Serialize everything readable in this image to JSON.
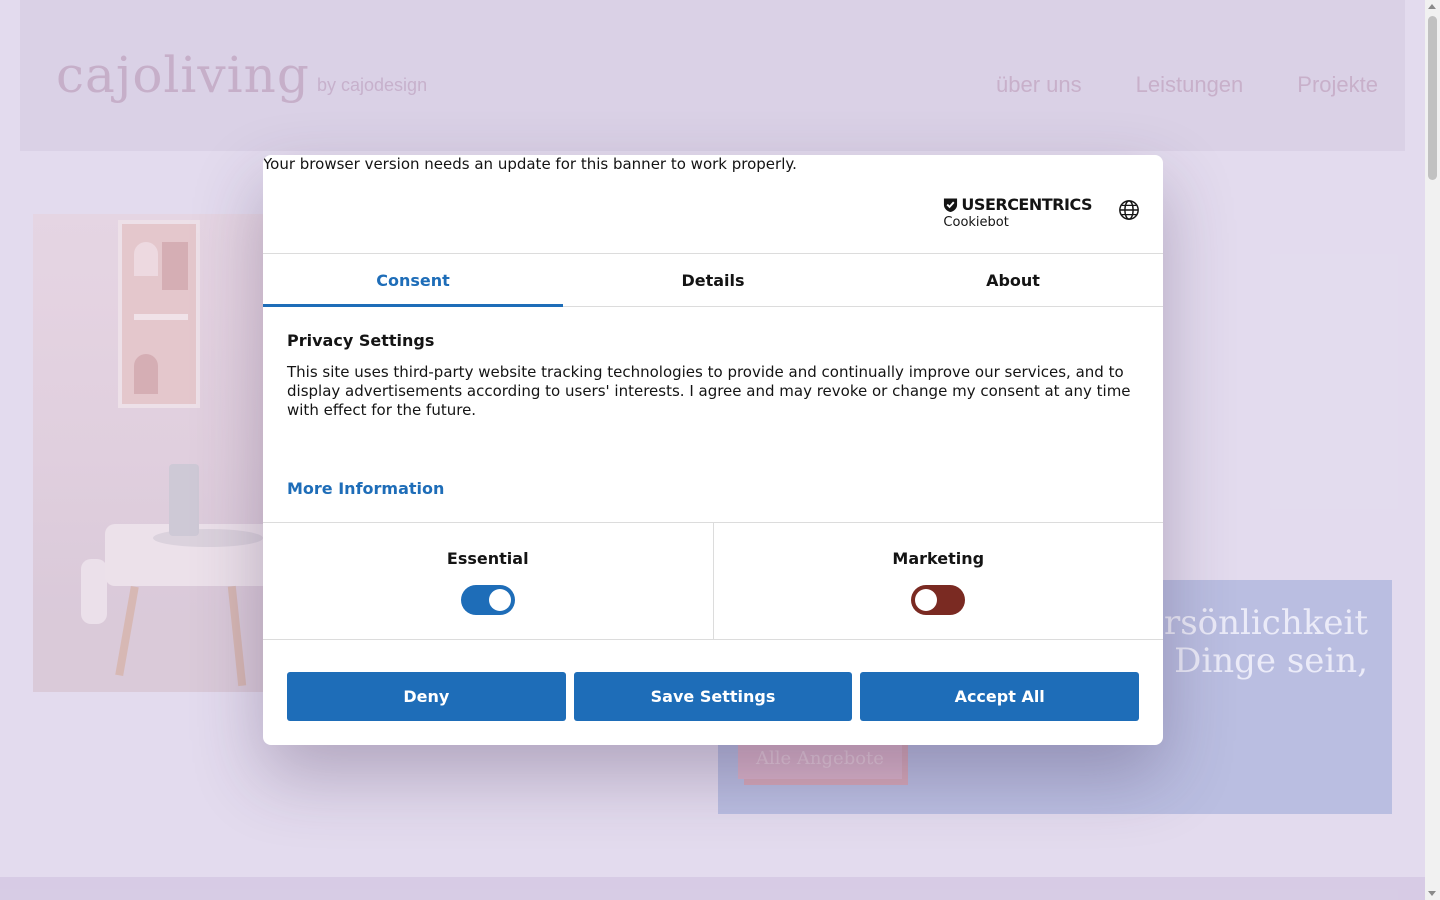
{
  "site": {
    "logo": "cajoliving",
    "logo_sub": "by cajodesign",
    "nav": [
      "über uns",
      "Leistungen",
      "Projekte"
    ],
    "quote_lines": [
      "ersönlichkeit",
      "Dinge sein,"
    ],
    "quote_button": "Alle Angebote"
  },
  "dialog": {
    "browser_message": "Your browser version needs an update for this banner to work properly.",
    "brand_top": "USERCENTRICS",
    "brand_bottom": "Cookiebot",
    "tabs": [
      {
        "label": "Consent",
        "active": true
      },
      {
        "label": "Details",
        "active": false
      },
      {
        "label": "About",
        "active": false
      }
    ],
    "heading": "Privacy Settings",
    "body": "This site uses third-party website tracking technologies to provide and continually improve our services, and to display advertisements according to users' interests. I agree and may revoke or change my consent at any time with effect for the future.",
    "more_info": "More Information",
    "toggles": [
      {
        "label": "Essential",
        "on": true
      },
      {
        "label": "Marketing",
        "on": false
      }
    ],
    "buttons": {
      "deny": "Deny",
      "save": "Save Settings",
      "accept": "Accept All"
    }
  },
  "colors": {
    "accent": "#1e6db8",
    "toggle_off": "#7a2a22",
    "page_bg": "#e5dff0"
  }
}
